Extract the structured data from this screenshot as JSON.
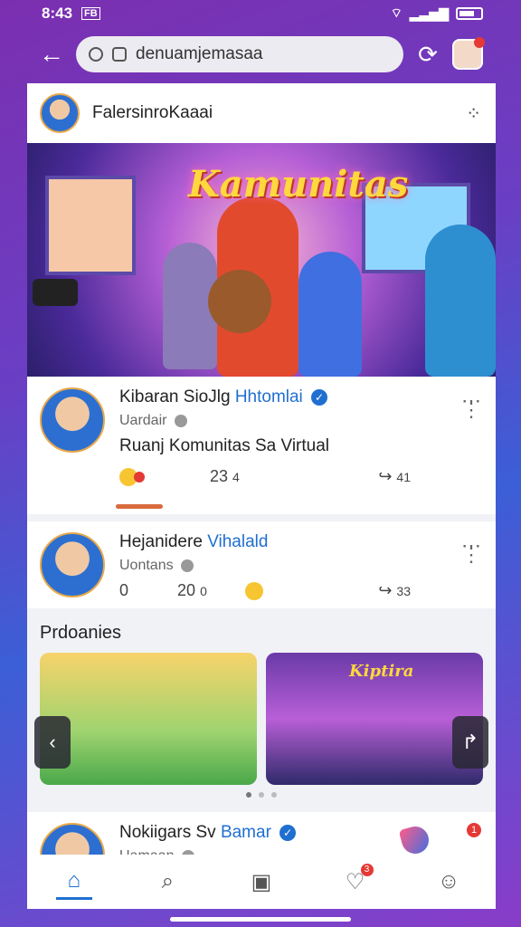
{
  "status_bar": {
    "time": "8:43",
    "indicator": "FB"
  },
  "topbar": {
    "url": "denuamjemasaa"
  },
  "page_header": {
    "title": "FalersinroKaaai"
  },
  "hero": {
    "title": "Kamunitas"
  },
  "post1": {
    "name": "Kibaran SioJlg",
    "name_highlight": "Hhtomlai",
    "subtitle": "Uardair",
    "body": "Ruanj Komunitas Sa Virtual",
    "reactions": "23",
    "reactions_extra": "4",
    "shares": "41"
  },
  "post2": {
    "name": "Hejanidere",
    "name_highlight": "Vihalald",
    "subtitle": "Uontans",
    "comments": "0",
    "reactions": "20",
    "reactions_extra": "0",
    "shares": "33"
  },
  "section": {
    "title": "Prdoanies"
  },
  "carousel": {
    "slide2_caption": "Kiptira"
  },
  "post3": {
    "name": "Nokiigars Sv",
    "name_highlight": "Bamar",
    "subtitle": "Uamaan",
    "badge": "1"
  },
  "nav": {
    "notification_badge": "3"
  }
}
